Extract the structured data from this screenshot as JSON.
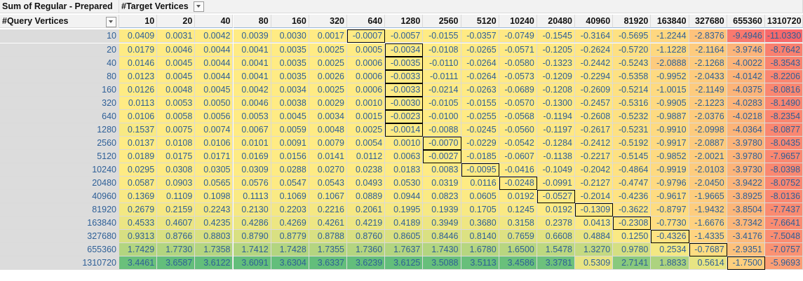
{
  "pivot": {
    "title": "Sum of Regular - Prepared",
    "column_field": "#Target Vertices",
    "row_field": "#Query Vertices",
    "column_headers": [
      "10",
      "20",
      "40",
      "80",
      "160",
      "320",
      "640",
      "1280",
      "2560",
      "5120",
      "10240",
      "20480",
      "40960",
      "81920",
      "163840",
      "327680",
      "655360",
      "1310720"
    ],
    "row_headers": [
      "10",
      "20",
      "40",
      "80",
      "160",
      "320",
      "640",
      "1280",
      "2560",
      "5120",
      "10240",
      "20480",
      "40960",
      "81920",
      "163840",
      "327680",
      "655360",
      "1310720"
    ],
    "rows": [
      [
        "0.0409",
        "0.0031",
        "0.0042",
        "0.0039",
        "0.0030",
        "0.0017",
        "-0.0007",
        "-0.0057",
        "-0.0155",
        "-0.0357",
        "-0.0749",
        "-0.1545",
        "-0.3164",
        "-0.5695",
        "-1.2244",
        "-2.8376",
        "-9.4946",
        "-11.0330"
      ],
      [
        "0.0179",
        "0.0046",
        "0.0044",
        "0.0041",
        "0.0035",
        "0.0025",
        "0.0005",
        "-0.0034",
        "-0.0108",
        "-0.0265",
        "-0.0571",
        "-0.1205",
        "-0.2624",
        "-0.5720",
        "-1.1228",
        "-2.1164",
        "-3.9746",
        "-8.7642"
      ],
      [
        "0.0146",
        "0.0045",
        "0.0044",
        "0.0041",
        "0.0035",
        "0.0025",
        "0.0006",
        "-0.0035",
        "-0.0110",
        "-0.0264",
        "-0.0580",
        "-0.1323",
        "-0.2442",
        "-0.5243",
        "-2.0888",
        "-2.1268",
        "-4.0022",
        "-8.3543"
      ],
      [
        "0.0123",
        "0.0045",
        "0.0044",
        "0.0041",
        "0.0035",
        "0.0026",
        "0.0006",
        "-0.0033",
        "-0.0111",
        "-0.0264",
        "-0.0573",
        "-0.1209",
        "-0.2294",
        "-0.5358",
        "-0.9952",
        "-2.0433",
        "-4.0142",
        "-8.2206"
      ],
      [
        "0.0126",
        "0.0048",
        "0.0045",
        "0.0042",
        "0.0034",
        "0.0025",
        "0.0006",
        "-0.0033",
        "-0.0214",
        "-0.0263",
        "-0.0689",
        "-0.1208",
        "-0.2609",
        "-0.5214",
        "-1.0015",
        "-2.1149",
        "-4.0375",
        "-8.0816"
      ],
      [
        "0.0113",
        "0.0053",
        "0.0050",
        "0.0046",
        "0.0038",
        "0.0029",
        "0.0010",
        "-0.0030",
        "-0.0105",
        "-0.0155",
        "-0.0570",
        "-0.1300",
        "-0.2457",
        "-0.5316",
        "-0.9905",
        "-2.1223",
        "-4.0283",
        "-8.1490"
      ],
      [
        "0.0106",
        "0.0058",
        "0.0056",
        "0.0053",
        "0.0045",
        "0.0034",
        "0.0015",
        "-0.0023",
        "-0.0100",
        "-0.0255",
        "-0.0568",
        "-0.1194",
        "-0.2608",
        "-0.5232",
        "-0.9887",
        "-2.0376",
        "-4.0218",
        "-8.2354"
      ],
      [
        "0.1537",
        "0.0075",
        "0.0074",
        "0.0067",
        "0.0059",
        "0.0048",
        "0.0025",
        "-0.0014",
        "-0.0088",
        "-0.0245",
        "-0.0560",
        "-0.1197",
        "-0.2617",
        "-0.5231",
        "-0.9910",
        "-2.0998",
        "-4.0364",
        "-8.0877"
      ],
      [
        "0.0137",
        "0.0108",
        "0.0106",
        "0.0101",
        "0.0091",
        "0.0079",
        "0.0054",
        "0.0010",
        "-0.0070",
        "-0.0229",
        "-0.0542",
        "-0.1284",
        "-0.2412",
        "-0.5192",
        "-0.9917",
        "-2.0887",
        "-3.9780",
        "-8.0435"
      ],
      [
        "0.0189",
        "0.0175",
        "0.0171",
        "0.0169",
        "0.0156",
        "0.0141",
        "0.0112",
        "0.0063",
        "-0.0027",
        "-0.0185",
        "-0.0607",
        "-0.1138",
        "-0.2217",
        "-0.5145",
        "-0.9852",
        "-2.0021",
        "-3.9780",
        "-7.9657"
      ],
      [
        "0.0295",
        "0.0308",
        "0.0305",
        "0.0309",
        "0.0288",
        "0.0270",
        "0.0238",
        "0.0183",
        "0.0083",
        "-0.0095",
        "-0.0416",
        "-0.1049",
        "-0.2042",
        "-0.4864",
        "-0.9919",
        "-2.0103",
        "-3.9730",
        "-8.0398"
      ],
      [
        "0.0587",
        "0.0903",
        "0.0565",
        "0.0576",
        "0.0547",
        "0.0543",
        "0.0493",
        "0.0530",
        "0.0319",
        "0.0116",
        "-0.0248",
        "-0.0991",
        "-0.2127",
        "-0.4747",
        "-0.9796",
        "-2.0450",
        "-3.9422",
        "-8.0752"
      ],
      [
        "0.1369",
        "0.1109",
        "0.1098",
        "0.1113",
        "0.1069",
        "0.1067",
        "0.0889",
        "0.0944",
        "0.0823",
        "0.0605",
        "0.0192",
        "-0.0527",
        "-0.2014",
        "-0.4236",
        "-0.9617",
        "-1.9665",
        "-3.8925",
        "-8.0136"
      ],
      [
        "0.2679",
        "0.2159",
        "0.2243",
        "0.2130",
        "0.2203",
        "0.2216",
        "0.2061",
        "0.1995",
        "0.1939",
        "0.1705",
        "0.1245",
        "0.0192",
        "-0.1309",
        "-0.3622",
        "-0.8797",
        "-1.9432",
        "-3.8504",
        "-7.7437"
      ],
      [
        "0.4533",
        "0.4607",
        "0.4235",
        "0.4286",
        "0.4269",
        "0.4261",
        "0.4219",
        "0.4189",
        "0.3949",
        "0.3680",
        "0.3158",
        "0.2378",
        "0.0413",
        "-0.2308",
        "-0.7730",
        "-1.6676",
        "-3.7342",
        "-7.6641"
      ],
      [
        "0.9313",
        "0.8766",
        "0.8803",
        "0.8790",
        "0.8779",
        "0.8788",
        "0.8760",
        "0.8605",
        "0.8446",
        "0.8140",
        "0.7659",
        "0.6608",
        "0.4884",
        "0.1250",
        "-0.4326",
        "-1.4335",
        "-3.4176",
        "-7.5048"
      ],
      [
        "1.7429",
        "1.7730",
        "1.7358",
        "1.7412",
        "1.7428",
        "1.7355",
        "1.7360",
        "1.7637",
        "1.7430",
        "1.6780",
        "1.6500",
        "1.5478",
        "1.3270",
        "0.9780",
        "0.2534",
        "-0.7687",
        "-2.9351",
        "-7.0757"
      ],
      [
        "3.4461",
        "3.6587",
        "3.6122",
        "3.6091",
        "3.6304",
        "3.6337",
        "3.6239",
        "3.6125",
        "3.5088",
        "3.5113",
        "3.4586",
        "3.3781",
        "0.5309",
        "2.7141",
        "1.8833",
        "0.5614",
        "-1.7500",
        "-5.9693"
      ]
    ],
    "color_scale": {
      "low": "#f8696b",
      "mid": "#ffeb84",
      "high": "#63be7b"
    }
  }
}
